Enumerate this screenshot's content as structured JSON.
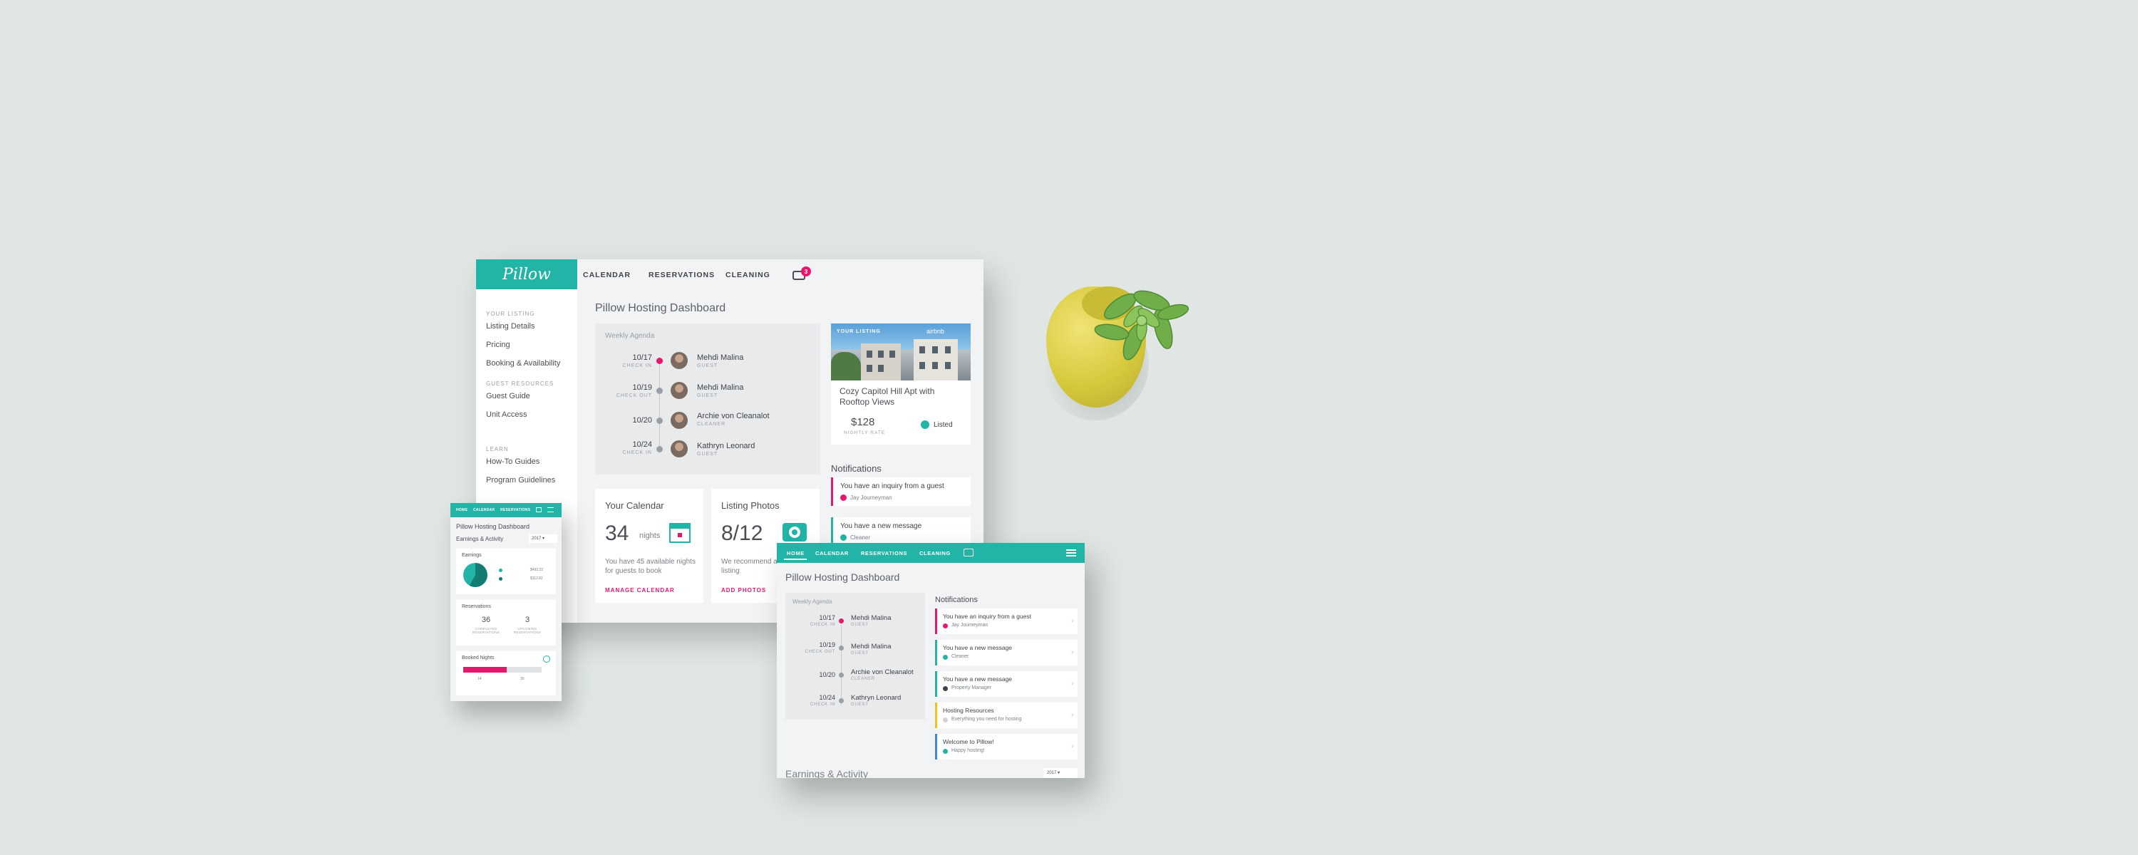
{
  "desktop": {
    "logo": "Pillow",
    "nav": [
      "CALENDAR",
      "RESERVATIONS",
      "CLEANING"
    ],
    "chat_badge": "3",
    "sidebar": {
      "sections": [
        {
          "title": "YOUR LISTING",
          "items": [
            "Listing Details",
            "Pricing",
            "Booking & Availability"
          ]
        },
        {
          "title": "GUEST RESOURCES",
          "items": [
            "Guest Guide",
            "Unit Access"
          ]
        },
        {
          "title": "LEARN",
          "items": [
            "How-To Guides",
            "Program Guidelines"
          ]
        }
      ]
    },
    "title": "Pillow Hosting Dashboard",
    "agenda": {
      "heading": "Weekly Agenda",
      "entries": [
        {
          "date": "10/17",
          "label": "CHECK IN",
          "name": "Mehdi Malina",
          "role": "GUEST"
        },
        {
          "date": "10/19",
          "label": "CHECK OUT",
          "name": "Mehdi Malina",
          "role": "GUEST"
        },
        {
          "date": "10/20",
          "label": "",
          "name": "Archie von Cleanalot",
          "role": "CLEANER"
        },
        {
          "date": "10/24",
          "label": "CHECK IN",
          "name": "Kathryn Leonard",
          "role": "GUEST"
        }
      ]
    },
    "listing": {
      "tag": "YOUR LISTING",
      "brand": "airbnb",
      "name": "Cozy Capitol Hill Apt with Rooftop Views",
      "price": "$128",
      "rate_label": "NIGHTLY RATE",
      "status": "Listed"
    },
    "notifications": {
      "title": "Notifications",
      "items": [
        {
          "text": "You have an inquiry from a guest",
          "sub": "Jay Journeyman"
        },
        {
          "text": "You have a new message",
          "sub": "Cleaner"
        }
      ]
    },
    "calendar_card": {
      "title": "Your Calendar",
      "big": "34",
      "unit": "nights",
      "desc": "You have 45 available nights for guests to book",
      "link": "MANAGE CALENDAR"
    },
    "photos_card": {
      "title": "Listing Photos",
      "big": "8/12",
      "desc": "We recommend at least 12 listing",
      "link": "ADD PHOTOS"
    }
  },
  "mobile": {
    "nav": [
      "HOME",
      "CALENDAR",
      "RESERVATIONS"
    ],
    "title": "Pillow Hosting Dashboard",
    "subtitle": "Earnings & Activity",
    "select": "2017 ▾",
    "earnings": {
      "title": "Earnings",
      "values": [
        "$492.22",
        "$112.82"
      ]
    },
    "reservations": {
      "title": "Reservations",
      "stats": [
        {
          "num": "36",
          "label": "COMPLETED RESERVATIONS"
        },
        {
          "num": "3",
          "label": "UPCOMING RESERVATIONS"
        }
      ]
    },
    "booked": {
      "title": "Booked Nights",
      "fill": 0.55,
      "ticks": [
        "14",
        "30"
      ]
    }
  },
  "tablet": {
    "nav": [
      "HOME",
      "CALENDAR",
      "RESERVATIONS",
      "CLEANING"
    ],
    "title": "Pillow Hosting Dashboard",
    "agenda": {
      "heading": "Weekly Agenda",
      "entries": [
        {
          "date": "10/17",
          "label": "CHECK IN",
          "name": "Mehdi Malina",
          "role": "GUEST"
        },
        {
          "date": "10/19",
          "label": "CHECK OUT",
          "name": "Mehdi Malina",
          "role": "GUEST"
        },
        {
          "date": "10/20",
          "label": "",
          "name": "Archie von Cleanalot",
          "role": "CLEANER"
        },
        {
          "date": "10/24",
          "label": "CHECK IN",
          "name": "Kathryn Leonard",
          "role": "GUEST"
        }
      ]
    },
    "notifications": {
      "title": "Notifications",
      "items": [
        {
          "text": "You have an inquiry from a guest",
          "sub": "Jay Journeyman"
        },
        {
          "text": "You have a new message",
          "sub": "Cleaner"
        },
        {
          "text": "You have a new message",
          "sub": "Property Manager"
        },
        {
          "text": "Hosting Resources",
          "sub": "Everything you need for hosting"
        },
        {
          "text": "Welcome to Pillow!",
          "sub": "Happy hosting!"
        }
      ]
    },
    "earnings_title": "Earnings & Activity",
    "select": "2017 ▾"
  }
}
